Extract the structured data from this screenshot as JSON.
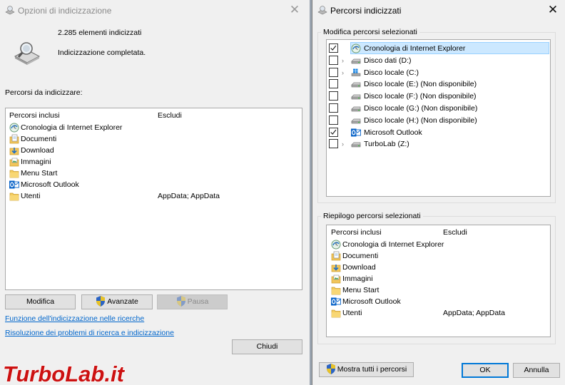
{
  "left_window": {
    "title": "Opzioni di indicizzazione",
    "count_text": "2.285 elementi indicizzati",
    "status_text": "Indicizzazione completata.",
    "section_label": "Percorsi da indicizzare:",
    "columns": {
      "included": "Percorsi inclusi",
      "excluded": "Escludi"
    },
    "items": [
      {
        "label": "Cronologia di Internet Explorer",
        "icon": "ie-history-icon",
        "exclude": ""
      },
      {
        "label": "Documenti",
        "icon": "documents-folder-icon",
        "exclude": ""
      },
      {
        "label": "Download",
        "icon": "download-folder-icon",
        "exclude": ""
      },
      {
        "label": "Immagini",
        "icon": "pictures-folder-icon",
        "exclude": ""
      },
      {
        "label": "Menu Start",
        "icon": "folder-icon",
        "exclude": ""
      },
      {
        "label": "Microsoft Outlook",
        "icon": "outlook-icon",
        "exclude": ""
      },
      {
        "label": "Utenti",
        "icon": "folder-icon",
        "exclude": "AppData; AppData"
      }
    ],
    "buttons": {
      "modify": "Modifica",
      "advanced": "Avanzate",
      "pause": "Pausa",
      "close": "Chiudi"
    },
    "links": {
      "search_indexing": "Funzione dell'indicizzazione nelle ricerche",
      "troubleshoot": "Risoluzione dei problemi di ricerca e indicizzazione"
    }
  },
  "right_window": {
    "title": "Percorsi indicizzati",
    "modify_group_label": "Modifica percorsi selezionati",
    "tree": [
      {
        "label": "Cronologia di Internet Explorer",
        "checked": true,
        "expandable": false,
        "selected": true,
        "icon": "ie-history-icon"
      },
      {
        "label": "Disco dati (D:)",
        "checked": false,
        "expandable": true,
        "selected": false,
        "icon": "drive-icon"
      },
      {
        "label": "Disco locale (C:)",
        "checked": false,
        "expandable": true,
        "selected": false,
        "icon": "windows-drive-icon"
      },
      {
        "label": "Disco locale (E:) (Non disponibile)",
        "checked": false,
        "expandable": false,
        "selected": false,
        "icon": "drive-icon"
      },
      {
        "label": "Disco locale (F:) (Non disponibile)",
        "checked": false,
        "expandable": false,
        "selected": false,
        "icon": "drive-icon"
      },
      {
        "label": "Disco locale (G:) (Non disponibile)",
        "checked": false,
        "expandable": false,
        "selected": false,
        "icon": "drive-icon"
      },
      {
        "label": "Disco locale (H:) (Non disponibile)",
        "checked": false,
        "expandable": false,
        "selected": false,
        "icon": "drive-icon"
      },
      {
        "label": "Microsoft Outlook",
        "checked": true,
        "expandable": false,
        "selected": false,
        "icon": "outlook-icon"
      },
      {
        "label": "TurboLab (Z:)",
        "checked": false,
        "expandable": true,
        "selected": false,
        "icon": "drive-icon"
      }
    ],
    "summary_group_label": "Riepilogo percorsi selezionati",
    "columns": {
      "included": "Percorsi inclusi",
      "excluded": "Escludi"
    },
    "summary_items": [
      {
        "label": "Cronologia di Internet Explorer",
        "icon": "ie-history-icon",
        "exclude": ""
      },
      {
        "label": "Documenti",
        "icon": "documents-folder-icon",
        "exclude": ""
      },
      {
        "label": "Download",
        "icon": "download-folder-icon",
        "exclude": ""
      },
      {
        "label": "Immagini",
        "icon": "pictures-folder-icon",
        "exclude": ""
      },
      {
        "label": "Menu Start",
        "icon": "folder-icon",
        "exclude": ""
      },
      {
        "label": "Microsoft Outlook",
        "icon": "outlook-icon",
        "exclude": ""
      },
      {
        "label": "Utenti",
        "icon": "folder-icon",
        "exclude": "AppData; AppData"
      }
    ],
    "buttons": {
      "show_all": "Mostra tutti i percorsi",
      "ok": "OK",
      "cancel": "Annulla"
    }
  },
  "watermark": {
    "text": "TurboLab.it"
  },
  "colors": {
    "link": "#0066cc",
    "accent": "#0078d7",
    "selection": "#cce8ff",
    "watermark_red": "#cc1111"
  }
}
